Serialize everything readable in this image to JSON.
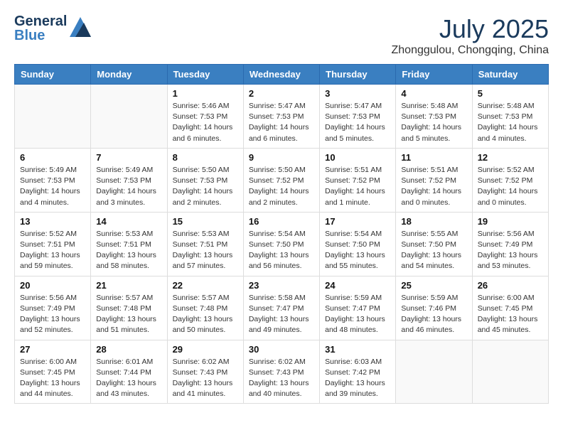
{
  "header": {
    "logo_line1": "General",
    "logo_line2": "Blue",
    "month_year": "July 2025",
    "location": "Zhonggulou, Chongqing, China"
  },
  "weekdays": [
    "Sunday",
    "Monday",
    "Tuesday",
    "Wednesday",
    "Thursday",
    "Friday",
    "Saturday"
  ],
  "weeks": [
    [
      {
        "day": "",
        "info": ""
      },
      {
        "day": "",
        "info": ""
      },
      {
        "day": "1",
        "info": "Sunrise: 5:46 AM\nSunset: 7:53 PM\nDaylight: 14 hours and 6 minutes."
      },
      {
        "day": "2",
        "info": "Sunrise: 5:47 AM\nSunset: 7:53 PM\nDaylight: 14 hours and 6 minutes."
      },
      {
        "day": "3",
        "info": "Sunrise: 5:47 AM\nSunset: 7:53 PM\nDaylight: 14 hours and 5 minutes."
      },
      {
        "day": "4",
        "info": "Sunrise: 5:48 AM\nSunset: 7:53 PM\nDaylight: 14 hours and 5 minutes."
      },
      {
        "day": "5",
        "info": "Sunrise: 5:48 AM\nSunset: 7:53 PM\nDaylight: 14 hours and 4 minutes."
      }
    ],
    [
      {
        "day": "6",
        "info": "Sunrise: 5:49 AM\nSunset: 7:53 PM\nDaylight: 14 hours and 4 minutes."
      },
      {
        "day": "7",
        "info": "Sunrise: 5:49 AM\nSunset: 7:53 PM\nDaylight: 14 hours and 3 minutes."
      },
      {
        "day": "8",
        "info": "Sunrise: 5:50 AM\nSunset: 7:53 PM\nDaylight: 14 hours and 2 minutes."
      },
      {
        "day": "9",
        "info": "Sunrise: 5:50 AM\nSunset: 7:52 PM\nDaylight: 14 hours and 2 minutes."
      },
      {
        "day": "10",
        "info": "Sunrise: 5:51 AM\nSunset: 7:52 PM\nDaylight: 14 hours and 1 minute."
      },
      {
        "day": "11",
        "info": "Sunrise: 5:51 AM\nSunset: 7:52 PM\nDaylight: 14 hours and 0 minutes."
      },
      {
        "day": "12",
        "info": "Sunrise: 5:52 AM\nSunset: 7:52 PM\nDaylight: 14 hours and 0 minutes."
      }
    ],
    [
      {
        "day": "13",
        "info": "Sunrise: 5:52 AM\nSunset: 7:51 PM\nDaylight: 13 hours and 59 minutes."
      },
      {
        "day": "14",
        "info": "Sunrise: 5:53 AM\nSunset: 7:51 PM\nDaylight: 13 hours and 58 minutes."
      },
      {
        "day": "15",
        "info": "Sunrise: 5:53 AM\nSunset: 7:51 PM\nDaylight: 13 hours and 57 minutes."
      },
      {
        "day": "16",
        "info": "Sunrise: 5:54 AM\nSunset: 7:50 PM\nDaylight: 13 hours and 56 minutes."
      },
      {
        "day": "17",
        "info": "Sunrise: 5:54 AM\nSunset: 7:50 PM\nDaylight: 13 hours and 55 minutes."
      },
      {
        "day": "18",
        "info": "Sunrise: 5:55 AM\nSunset: 7:50 PM\nDaylight: 13 hours and 54 minutes."
      },
      {
        "day": "19",
        "info": "Sunrise: 5:56 AM\nSunset: 7:49 PM\nDaylight: 13 hours and 53 minutes."
      }
    ],
    [
      {
        "day": "20",
        "info": "Sunrise: 5:56 AM\nSunset: 7:49 PM\nDaylight: 13 hours and 52 minutes."
      },
      {
        "day": "21",
        "info": "Sunrise: 5:57 AM\nSunset: 7:48 PM\nDaylight: 13 hours and 51 minutes."
      },
      {
        "day": "22",
        "info": "Sunrise: 5:57 AM\nSunset: 7:48 PM\nDaylight: 13 hours and 50 minutes."
      },
      {
        "day": "23",
        "info": "Sunrise: 5:58 AM\nSunset: 7:47 PM\nDaylight: 13 hours and 49 minutes."
      },
      {
        "day": "24",
        "info": "Sunrise: 5:59 AM\nSunset: 7:47 PM\nDaylight: 13 hours and 48 minutes."
      },
      {
        "day": "25",
        "info": "Sunrise: 5:59 AM\nSunset: 7:46 PM\nDaylight: 13 hours and 46 minutes."
      },
      {
        "day": "26",
        "info": "Sunrise: 6:00 AM\nSunset: 7:45 PM\nDaylight: 13 hours and 45 minutes."
      }
    ],
    [
      {
        "day": "27",
        "info": "Sunrise: 6:00 AM\nSunset: 7:45 PM\nDaylight: 13 hours and 44 minutes."
      },
      {
        "day": "28",
        "info": "Sunrise: 6:01 AM\nSunset: 7:44 PM\nDaylight: 13 hours and 43 minutes."
      },
      {
        "day": "29",
        "info": "Sunrise: 6:02 AM\nSunset: 7:43 PM\nDaylight: 13 hours and 41 minutes."
      },
      {
        "day": "30",
        "info": "Sunrise: 6:02 AM\nSunset: 7:43 PM\nDaylight: 13 hours and 40 minutes."
      },
      {
        "day": "31",
        "info": "Sunrise: 6:03 AM\nSunset: 7:42 PM\nDaylight: 13 hours and 39 minutes."
      },
      {
        "day": "",
        "info": ""
      },
      {
        "day": "",
        "info": ""
      }
    ]
  ]
}
